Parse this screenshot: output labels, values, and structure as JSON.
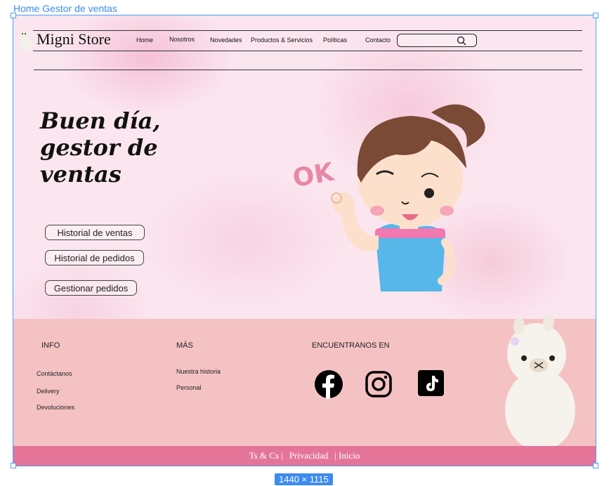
{
  "canvas": {
    "frame_label": "Home Gestor de ventas",
    "size_badge": "1440 × 1115"
  },
  "header": {
    "brand": "Migni Store",
    "nav": [
      "Home",
      "Nosotros",
      "Novedades",
      "Productos & Servicios",
      "Políticas",
      "Contacto"
    ],
    "search": {
      "placeholder": "",
      "icon": "search-icon"
    }
  },
  "hero": {
    "greeting": "Buen día, gestor de ventas",
    "buttons": [
      "Historial de  ventas",
      "Historial de  pedidos",
      "Gestionar pedidos"
    ],
    "illustration_text": "OK"
  },
  "footer": {
    "info_title": "INFO",
    "info_links": [
      "Contáctanos",
      "Delivery",
      "Devoluciones"
    ],
    "mas_title": "MÁS",
    "mas_links": [
      "Nuestra historia",
      "Personal"
    ],
    "social_title": "ENCUENTRANOS EN",
    "social_icons": [
      "facebook-icon",
      "instagram-icon",
      "tiktok-icon"
    ],
    "bottom_links": [
      "Ts & Cs |",
      "Privacidad",
      "| Inicio"
    ]
  },
  "colors": {
    "hero_bg": "#fbe6ef",
    "footer_bg": "#f5c2c4",
    "bottom_bar": "#e47599",
    "selection": "#3d8bf0"
  }
}
